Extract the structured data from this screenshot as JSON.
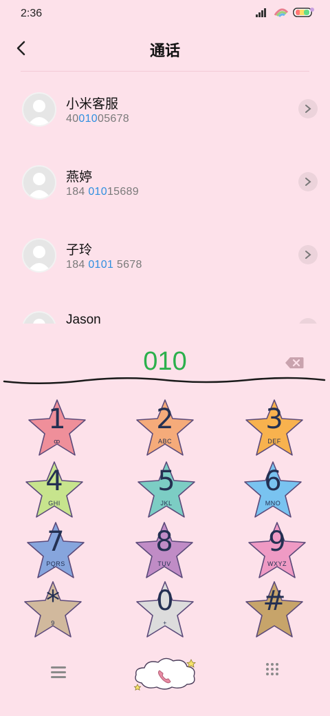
{
  "status": {
    "time": "2:36"
  },
  "header": {
    "title": "通话"
  },
  "contacts": [
    {
      "name": "小米客服",
      "num_pre": "40",
      "num_hl": "010",
      "num_post": "05678"
    },
    {
      "name": "燕婷",
      "num_pre": "184 ",
      "num_hl": "010",
      "num_post": "15689"
    },
    {
      "name": "子玲",
      "num_pre": "184 ",
      "num_hl": "0101",
      "num_post": " 5678"
    },
    {
      "name": "Jason",
      "num_pre": "",
      "num_hl": "",
      "num_post": ""
    }
  ],
  "input": {
    "digits": "010"
  },
  "keys": [
    {
      "num": "1",
      "letters": "ꝏ",
      "color": "#ef8f9a"
    },
    {
      "num": "2",
      "letters": "ABC",
      "color": "#f5ab7a"
    },
    {
      "num": "3",
      "letters": "DEF",
      "color": "#f8b24e"
    },
    {
      "num": "4",
      "letters": "GHI",
      "color": "#c7e48d"
    },
    {
      "num": "5",
      "letters": "JKL",
      "color": "#7ccdc4"
    },
    {
      "num": "6",
      "letters": "MNO",
      "color": "#79c3f0"
    },
    {
      "num": "7",
      "letters": "PQRS",
      "color": "#86a5dd"
    },
    {
      "num": "8",
      "letters": "TUV",
      "color": "#c08cc6"
    },
    {
      "num": "9",
      "letters": "WXYZ",
      "color": "#ef9ac4"
    },
    {
      "num": "*",
      "letters": "9",
      "color": "#d1b99d"
    },
    {
      "num": "0",
      "letters": "+",
      "color": "#dcdcdc"
    },
    {
      "num": "#",
      "letters": "",
      "color": "#c7a46a"
    }
  ],
  "colors": {
    "background": "#fde1ea",
    "digits": "#2bb04c",
    "highlight": "#2f8fe0"
  }
}
